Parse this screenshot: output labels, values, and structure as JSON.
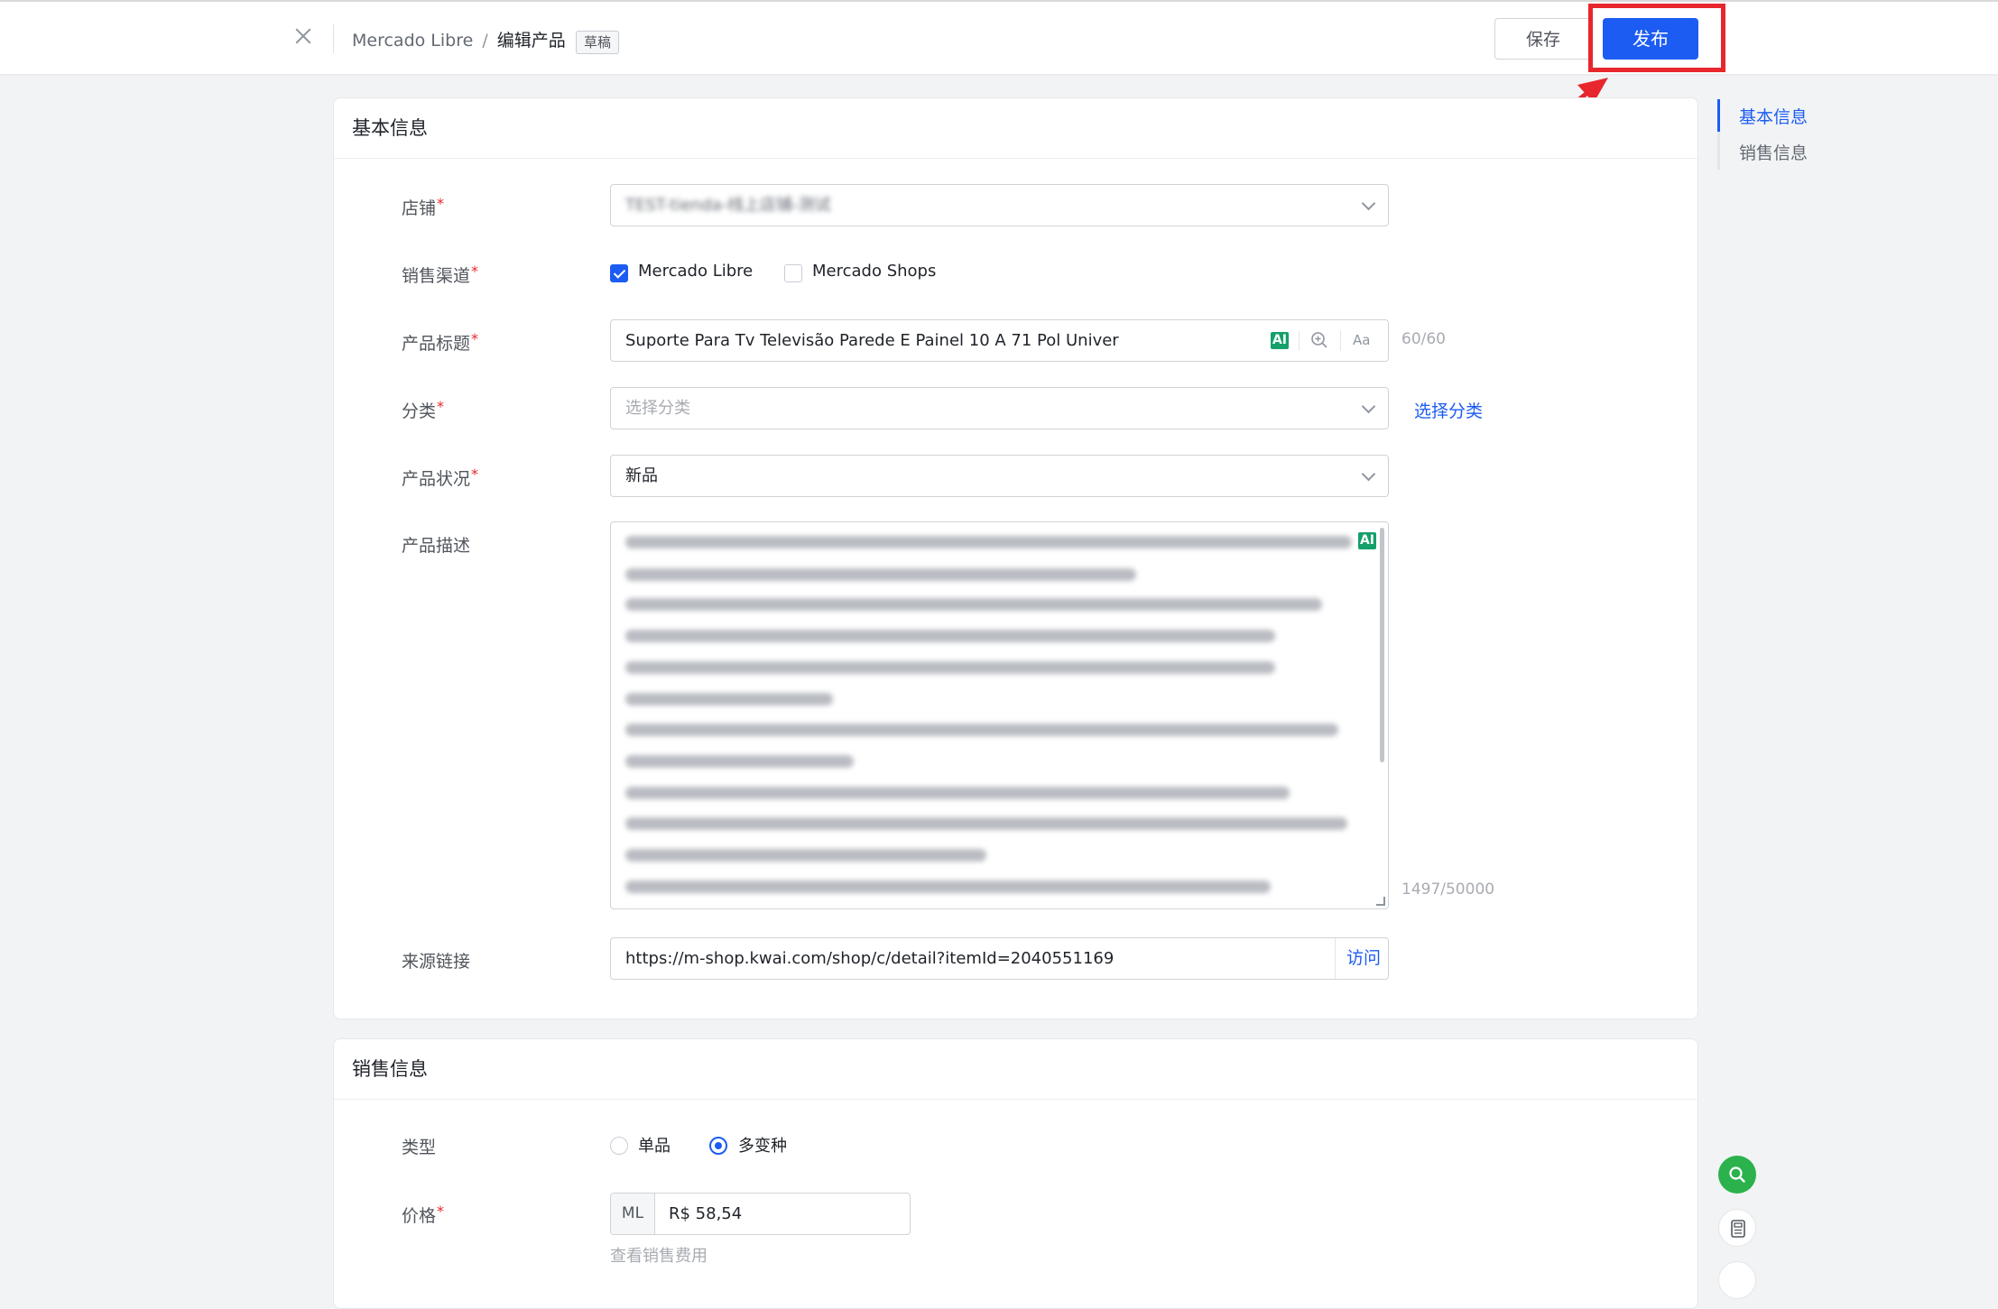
{
  "header": {
    "breadcrumb_root": "Mercado Libre",
    "breadcrumb_sep": "/",
    "breadcrumb_current": "编辑产品",
    "draft_tag": "草稿",
    "save_label": "保存",
    "publish_label": "发布"
  },
  "basic": {
    "title": "基本信息",
    "store": {
      "label": "店铺",
      "value": "TEST-tienda-线上店铺-测试"
    },
    "channel": {
      "label": "销售渠道",
      "options": [
        {
          "label": "Mercado Libre",
          "checked": true
        },
        {
          "label": "Mercado Shops",
          "checked": false
        }
      ]
    },
    "product_title": {
      "label": "产品标题",
      "value": "Suporte Para Tv Televisão Parede E Painel 10 A 71 Pol Univer",
      "ai_badge": "AI",
      "case_tool": "Aa",
      "counter": "60/60"
    },
    "category": {
      "label": "分类",
      "placeholder": "选择分类",
      "link": "选择分类"
    },
    "condition": {
      "label": "产品状况",
      "value": "新品"
    },
    "description": {
      "label": "产品描述",
      "ai_badge": "AI",
      "counter": "1497/50000"
    },
    "source": {
      "label": "来源链接",
      "value": "https://m-shop.kwai.com/shop/c/detail?itemId=2040551169",
      "visit": "访问"
    }
  },
  "sales": {
    "title": "销售信息",
    "type": {
      "label": "类型",
      "options": [
        {
          "label": "单品",
          "checked": false
        },
        {
          "label": "多变种",
          "checked": true
        }
      ]
    },
    "price": {
      "label": "价格",
      "prefix": "ML",
      "value": "R$ 58,54",
      "fee_link": "查看销售费用"
    }
  },
  "anchor_nav": {
    "items": [
      {
        "label": "基本信息",
        "active": true
      },
      {
        "label": "销售信息",
        "active": false
      }
    ]
  },
  "colors": {
    "primary": "#1c5cf2",
    "highlight_frame": "#e8262d",
    "ai_badge": "#14a06a",
    "float_search": "#2bb24c"
  },
  "icons": [
    "close-icon",
    "chevron-down-icon",
    "search-zoom-icon",
    "check-icon",
    "search-icon",
    "calculator-icon",
    "annotation-arrow-icon"
  ]
}
